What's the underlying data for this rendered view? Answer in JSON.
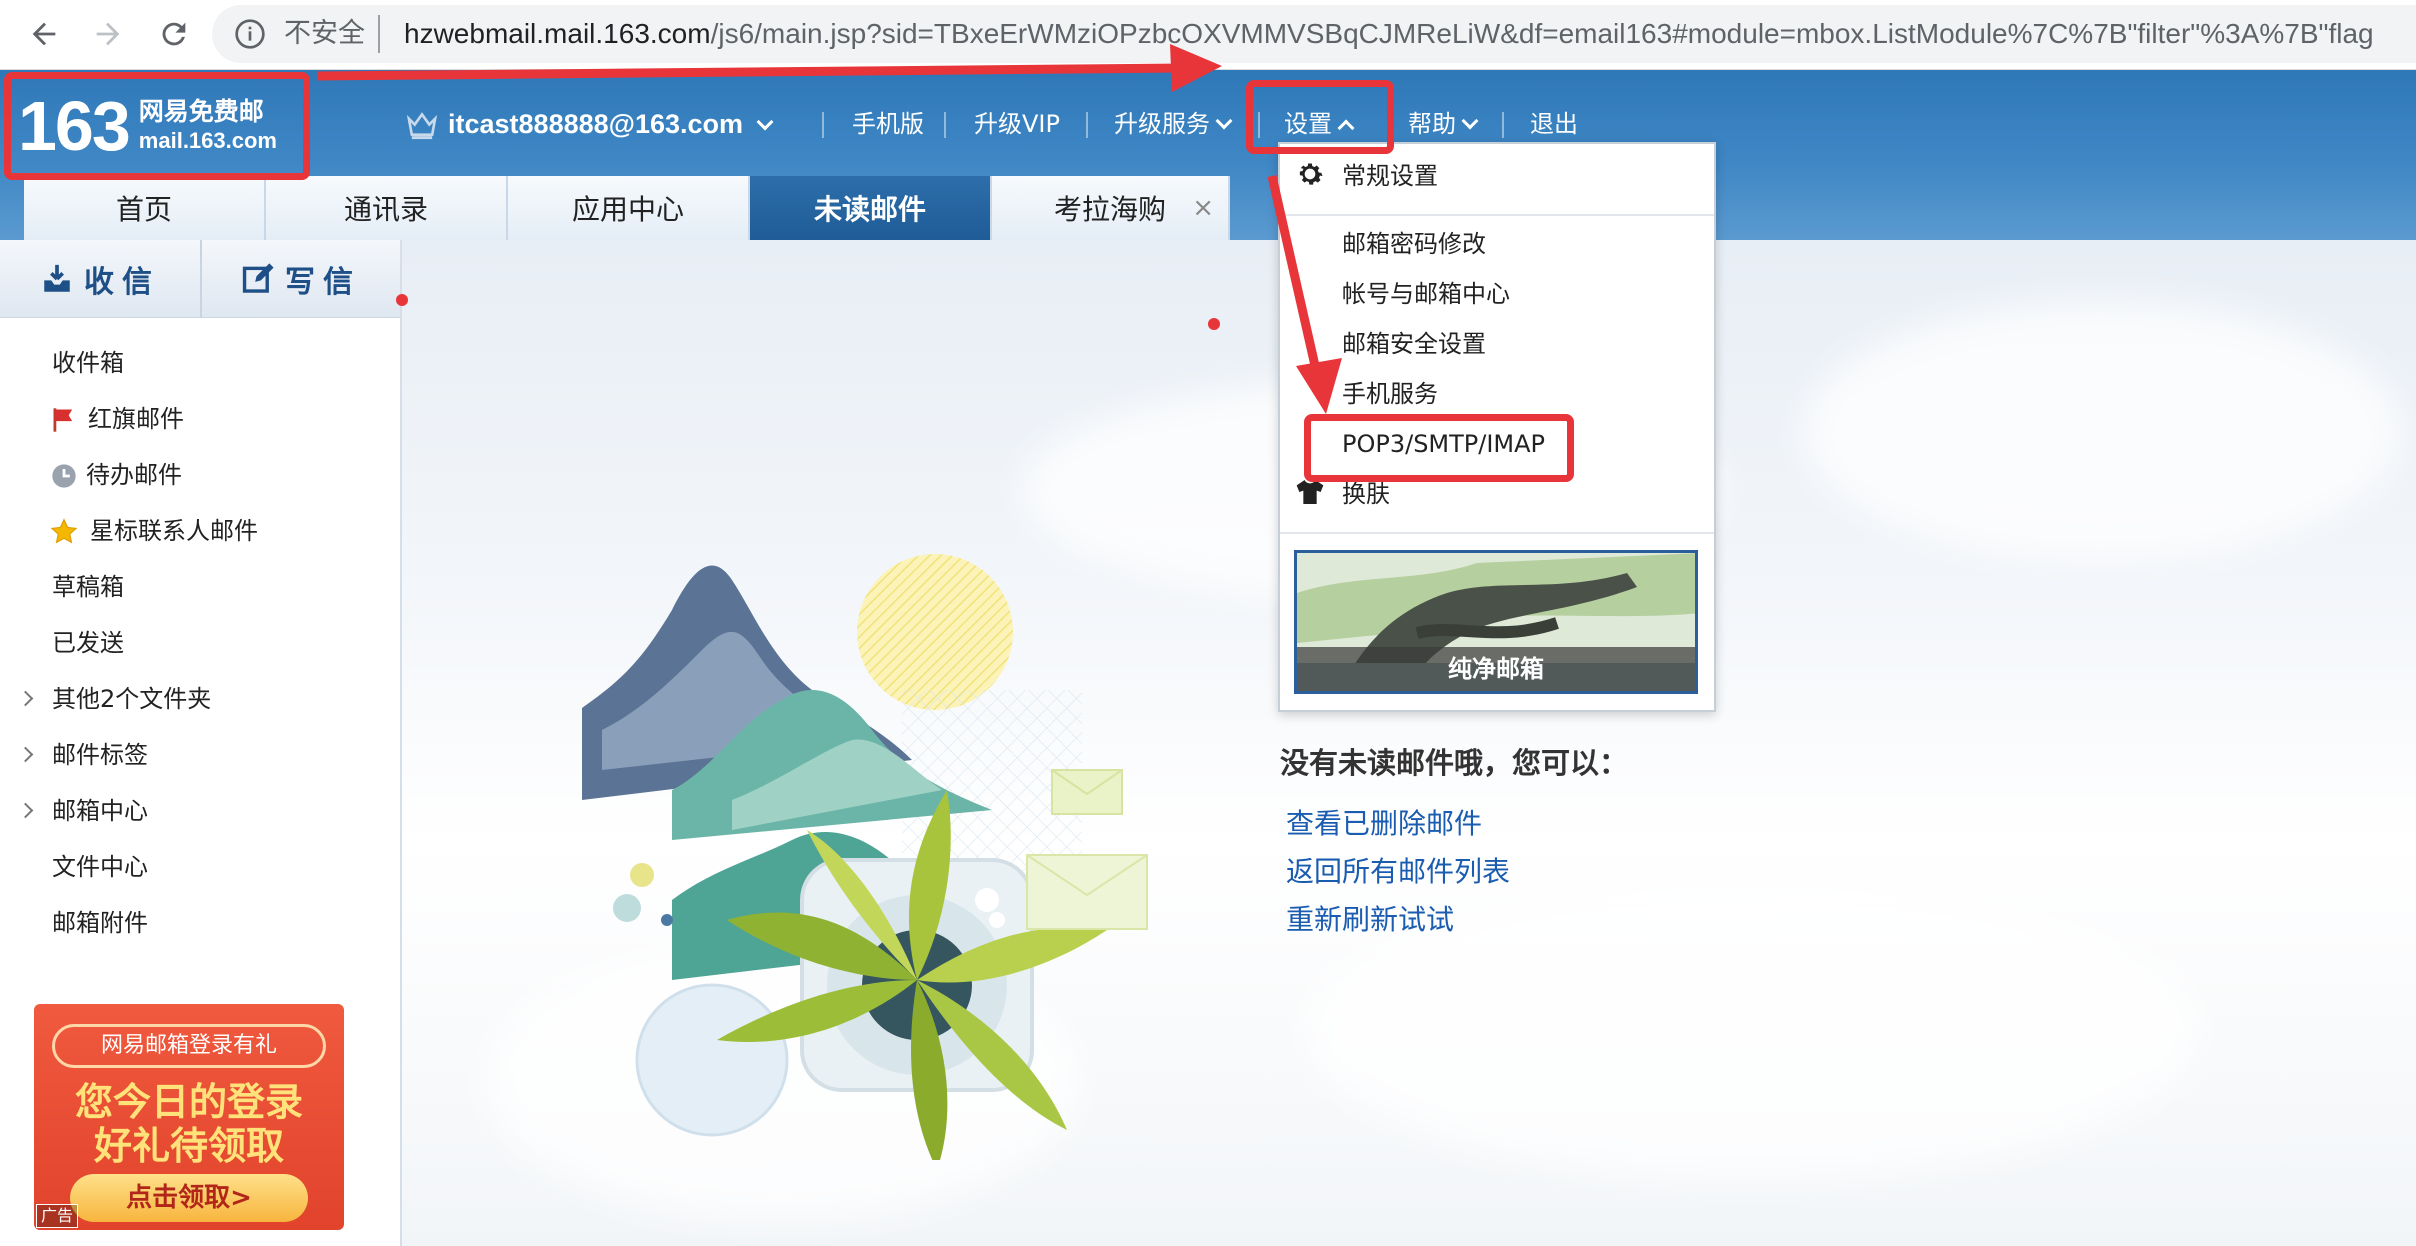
{
  "browser": {
    "security_label": "不安全",
    "url_host": "hzwebmail.mail.163.com",
    "url_rest": "/js6/main.jsp?sid=TBxeErWMziOPzbcOXVMMVSBqCJMReLiW&df=email163#module=mbox.ListModule%7C%7B\"filter\"%3A%7B\"flag"
  },
  "logo": {
    "number": "163",
    "line1": "网易免费邮",
    "line2": "mail.163.com"
  },
  "topbar": {
    "email": "itcast888888@163.com",
    "mobile": "手机版",
    "vip": "升级VIP",
    "upgrade_service": "升级服务",
    "settings": "设置",
    "help": "帮助",
    "logout": "退出"
  },
  "tabs": [
    {
      "label": "首页"
    },
    {
      "label": "通讯录"
    },
    {
      "label": "应用中心"
    },
    {
      "label": "未读邮件"
    },
    {
      "label": "考拉海购"
    }
  ],
  "tab_close": "×",
  "sidebar": {
    "receive": "收信",
    "compose": "写信",
    "folders": [
      {
        "label": "收件箱"
      },
      {
        "label": "红旗邮件",
        "icon": "red-flag-icon"
      },
      {
        "label": "待办邮件",
        "icon": "clock-icon"
      },
      {
        "label": "星标联系人邮件",
        "icon": "star-icon"
      },
      {
        "label": "草稿箱"
      },
      {
        "label": "已发送"
      },
      {
        "label": "其他2个文件夹"
      },
      {
        "label": "邮件标签"
      },
      {
        "label": "邮箱中心"
      },
      {
        "label": "文件中心"
      },
      {
        "label": "邮箱附件"
      }
    ]
  },
  "ad": {
    "header": "网易邮箱登录有礼",
    "line1": "您今日的登录",
    "line2": "好礼待领取",
    "button": "点击领取>",
    "tag": "广告"
  },
  "main": {
    "empty_title": "没有未读邮件哦，您可以：",
    "links": [
      "查看已删除邮件",
      "返回所有邮件列表",
      "重新刷新试试"
    ]
  },
  "settings_menu": {
    "general": "常规设置",
    "password": "邮箱密码修改",
    "account": "帐号与邮箱中心",
    "security": "邮箱安全设置",
    "mobile_service": "手机服务",
    "pop3": "POP3/SMTP/IMAP",
    "skin": "换肤",
    "skin_name": "纯净邮箱"
  },
  "colors": {
    "header_blue": "#3f87c5",
    "tab_active": "#1f5c97",
    "link_blue": "#1a5cb0",
    "annotation_red": "#e8353a"
  }
}
